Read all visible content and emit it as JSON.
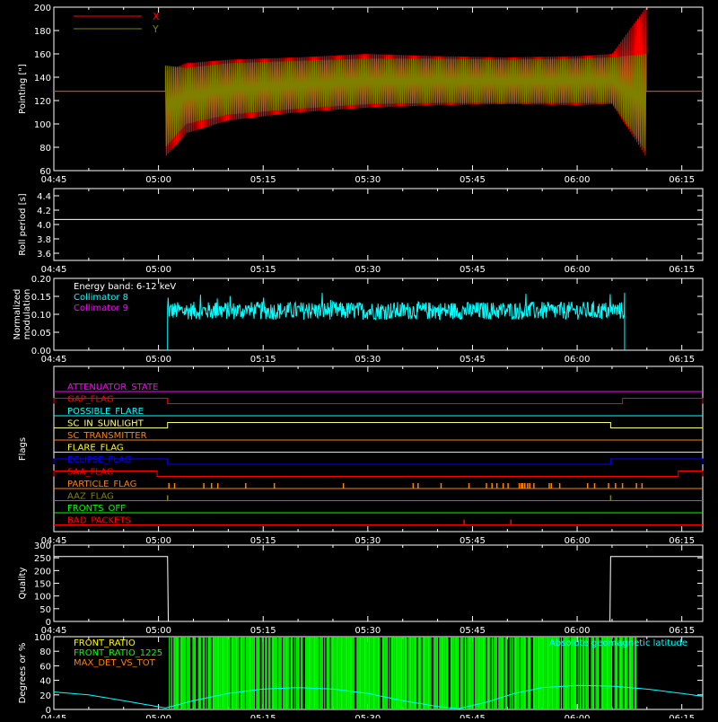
{
  "colors": {
    "background": "#000000",
    "axes": "#ffffff",
    "x_series": "#ff0000",
    "y_series": "#808000",
    "collimator8": "#00ffff",
    "collimator9": "#ff00ff",
    "front_ratio": "#ffff00",
    "front_ratio_1225": "#00ff00",
    "max_det_vs_tot": "#ff8000",
    "geomag_lat": "#00ffff"
  },
  "time_ticks": [
    "04:45",
    "05:00",
    "05:15",
    "05:30",
    "05:45",
    "06:00",
    "06:15"
  ],
  "chart_data": [
    {
      "id": "pointing",
      "type": "line",
      "title": "",
      "ylabel": "Pointing [\"]",
      "ylim": [
        60,
        200
      ],
      "yticks": [
        "60",
        "80",
        "100",
        "120",
        "140",
        "160",
        "180",
        "200"
      ],
      "xlim_minutes": [
        0,
        93
      ],
      "x_ticks": [
        "04:45",
        "05:00",
        "05:15",
        "05:30",
        "05:45",
        "06:00",
        "06:15"
      ],
      "legend_position": "top-left",
      "series": [
        {
          "name": "X",
          "color": "#ff0000",
          "x": [
            0,
            16,
            19,
            25,
            35,
            45,
            55,
            65,
            75,
            80,
            84.9
          ],
          "y_upper": [
            128,
            145,
            152,
            155,
            157,
            160,
            158,
            157,
            158,
            160,
            200
          ],
          "y_lower": [
            128,
            72,
            92,
            103,
            110,
            114,
            116,
            117,
            116,
            117,
            72
          ],
          "baseline": 128
        },
        {
          "name": "Y",
          "color": "#808000",
          "x": [
            0,
            16,
            19,
            25,
            35,
            45,
            55,
            65,
            75,
            80,
            84.9
          ],
          "y_upper": [
            128,
            150,
            148,
            152,
            154,
            156,
            156,
            155,
            156,
            157,
            160
          ],
          "y_lower": [
            128,
            80,
            100,
            108,
            113,
            117,
            118,
            118,
            118,
            118,
            76
          ],
          "baseline": 128
        }
      ]
    },
    {
      "id": "roll_period",
      "type": "line",
      "ylabel": "Roll period [s]",
      "ylim": [
        3.5,
        4.5
      ],
      "yticks": [
        "3.6",
        "3.8",
        "4.0",
        "4.2",
        "4.4"
      ],
      "series": [
        {
          "name": "",
          "x": [
            0,
            93
          ],
          "y": [
            4.07,
            4.07
          ]
        }
      ]
    },
    {
      "id": "modulation",
      "type": "line",
      "ylabel": "Normalized modulation",
      "ylim": [
        0,
        0.2
      ],
      "yticks": [
        "0.00",
        "0.05",
        "0.10",
        "0.15",
        "0.20"
      ],
      "annotation": "Energy band: 6-12 keV",
      "series": [
        {
          "name": "Collimator 8",
          "color": "#00ffff",
          "x_start": 16.3,
          "x_end": 81.8,
          "mean": 0.11,
          "jitter": 0.025
        },
        {
          "name": "Collimator 9",
          "color": "#ff00ff"
        }
      ]
    },
    {
      "id": "flags",
      "type": "line",
      "ylabel": "Flags",
      "series": [
        {
          "name": "ATTENUATOR_STATE",
          "color": "#ff00ff",
          "segments": []
        },
        {
          "name": "GAP_FLAG",
          "color": "#ff0000",
          "segments": [
            [
              0,
              16.3
            ],
            [
              81.5,
              93
            ]
          ]
        },
        {
          "name": "POSSIBLE_FLARE",
          "color": "#00ffff",
          "segments": []
        },
        {
          "name": "SC_IN_SUNLIGHT",
          "color": "#ffff80",
          "segments": [
            [
              16.3,
              79.8
            ]
          ]
        },
        {
          "name": "SC_TRANSMITTER",
          "color": "#ff8000",
          "segments": []
        },
        {
          "name": "FLARE_FLAG",
          "color": "#ffff00",
          "segments": []
        },
        {
          "name": "ECLIPSE_FLAG",
          "color": "#0000ff",
          "segments": [
            [
              0,
              16.3
            ],
            [
              79.8,
              93
            ]
          ]
        },
        {
          "name": "SAA_FLAG",
          "color": "#ff0000",
          "segments": [
            [
              0,
              14.8
            ],
            [
              89.5,
              93
            ]
          ]
        },
        {
          "name": "PARTICLE_FLAG",
          "color": "#ff8000",
          "spikes": [
            16.5,
            17.3,
            21.5,
            22.6,
            23.5,
            27.5,
            31.6,
            41.5,
            51.5,
            52.2,
            55.5,
            59.5,
            62.0,
            62.8,
            63.5,
            64.4,
            65.1,
            66.7,
            67.0,
            67.2,
            67.5,
            67.9,
            68.2,
            68.8,
            71.0,
            71.3,
            72.5,
            76.5,
            77.5,
            79.5,
            80.5,
            81.5,
            83.5,
            84.3
          ]
        },
        {
          "name": "AAZ_FLAG",
          "color": "#808000",
          "spikes": [
            16.3,
            79.8
          ]
        },
        {
          "name": "FRONTS_OFF",
          "color": "#00ff00",
          "segments": []
        },
        {
          "name": "BAD_PACKETS",
          "color": "#ff0000",
          "spikes": [
            58.8,
            65.5
          ]
        }
      ]
    },
    {
      "id": "quality",
      "type": "line",
      "ylabel": "Quality",
      "ylim": [
        0,
        300
      ],
      "yticks": [
        "0",
        "50",
        "100",
        "150",
        "200",
        "250",
        "300"
      ],
      "series": [
        {
          "name": "",
          "x": [
            0,
            16.3,
            16.4,
            79.7,
            79.8,
            93
          ],
          "y": [
            255,
            255,
            0,
            0,
            255,
            255
          ]
        }
      ]
    },
    {
      "id": "ratios",
      "type": "line",
      "ylabel": "Degrees or %",
      "ylim": [
        0,
        100
      ],
      "yticks": [
        "0",
        "20",
        "40",
        "60",
        "80",
        "100"
      ],
      "annotation": "Absolute geomagnetic latitude",
      "series": [
        {
          "name": "FRONT_RATIO",
          "color": "#ffff00"
        },
        {
          "name": "FRONT_RATIO_1225",
          "color": "#00ff00",
          "x_start": 16.5,
          "x_end": 83.5
        },
        {
          "name": "MAX_DET_VS_TOT",
          "color": "#ff8000"
        },
        {
          "name": "Absolute geomagnetic latitude",
          "color": "#00ffff",
          "x": [
            0,
            5,
            10,
            16,
            20,
            25,
            30,
            35,
            40,
            45,
            50,
            55,
            58,
            62,
            66,
            70,
            75,
            80,
            85,
            90,
            93
          ],
          "y": [
            24,
            20,
            12,
            2,
            12,
            22,
            28,
            30,
            28,
            22,
            12,
            4,
            1,
            10,
            22,
            30,
            33,
            32,
            28,
            22,
            18
          ]
        }
      ]
    }
  ]
}
